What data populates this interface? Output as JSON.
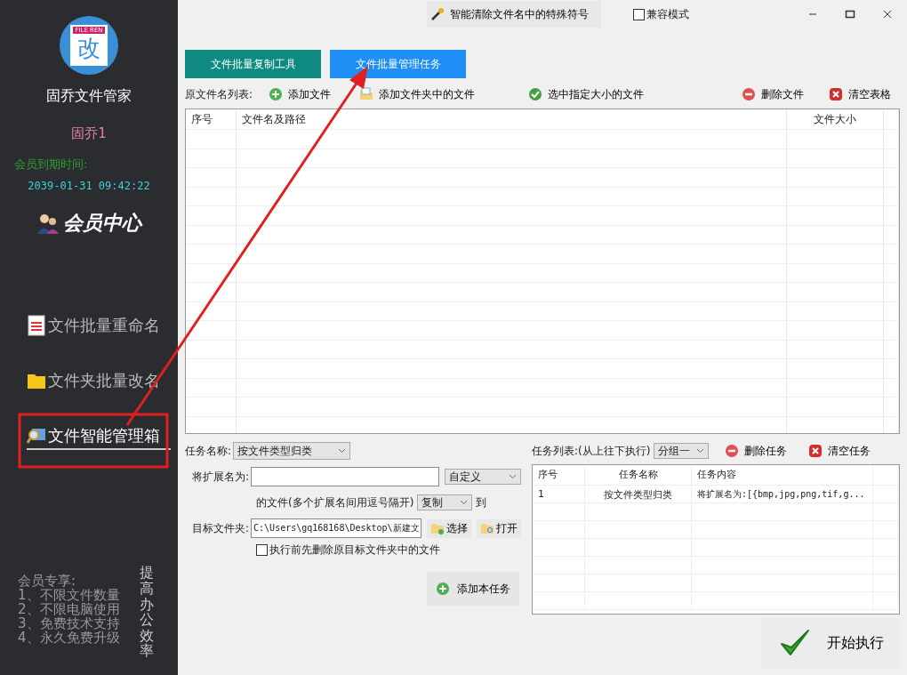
{
  "window": {
    "tool_button": "智能清除文件名中的特殊符号",
    "compat": {
      "label": "兼容模式",
      "checked": false
    }
  },
  "sidebar": {
    "logo_text": "FILE REN",
    "logo_char": "改",
    "app_name": "固乔文件管家",
    "user": "固乔1",
    "expiry_label": "会员到期时间:",
    "expiry": "2039-01-31 09:42:22",
    "member_center": "会员中心",
    "nav": [
      {
        "label": "文件批量重命名",
        "kind": "doc",
        "selected": false
      },
      {
        "label": "文件夹批量改名",
        "kind": "folder",
        "selected": false
      },
      {
        "label": "文件智能管理箱",
        "kind": "search",
        "selected": true
      }
    ],
    "perks": [
      "会员专享:",
      "1、不限文件数量",
      "2、不限电脑使用",
      "3、免费技术支持",
      "4、永久免费升级"
    ],
    "slogan": "提高办公效率"
  },
  "tabs": [
    {
      "label": "文件批量复制工具",
      "selected": false
    },
    {
      "label": "文件批量管理任务",
      "selected": true
    }
  ],
  "file_list": {
    "label": "原文件名列表:",
    "actions": [
      {
        "label": "添加文件",
        "kind": "add"
      },
      {
        "label": "添加文件夹中的文件",
        "kind": "folder"
      },
      {
        "label": "选中指定大小的文件",
        "kind": "check"
      },
      {
        "label": "删除文件",
        "kind": "remove"
      },
      {
        "label": "清空表格",
        "kind": "clear"
      }
    ],
    "columns": [
      "序号",
      "文件名及路径",
      "文件大小"
    ]
  },
  "task_form": {
    "name_label": "任务名称:",
    "name_value": "按文件类型归类",
    "ext_label": "将扩展名为:",
    "ext_mode": "自定义",
    "files_note": "的文件(多个扩展名间用逗号隔开)",
    "action": "复制",
    "to": "到",
    "target_label": "目标文件夹:",
    "target_path": "C:\\Users\\gq168168\\Desktop\\新建文",
    "choose": "选择",
    "open": "打开",
    "delete_first": {
      "label": "执行前先删除原目标文件夹中的文件",
      "checked": false
    },
    "add_task": "添加本任务"
  },
  "task_list": {
    "label": "任务列表:(从上往下执行)",
    "group": "分组一",
    "actions": [
      {
        "label": "删除任务",
        "kind": "remove"
      },
      {
        "label": "清空任务",
        "kind": "clear"
      }
    ],
    "columns": [
      "序号",
      "任务名称",
      "任务内容"
    ],
    "rows": [
      {
        "no": "1",
        "name": "按文件类型归类",
        "content": "将扩展名为:[{bmp,jpg,png,tif,g..."
      }
    ]
  },
  "start_button": "开始执行"
}
